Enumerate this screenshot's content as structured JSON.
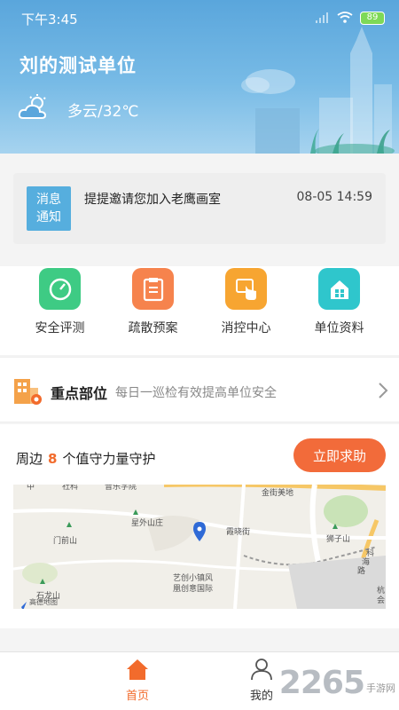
{
  "status_bar": {
    "time": "下午3:45",
    "battery": "89"
  },
  "header": {
    "unit_name": "刘的测试单位",
    "weather": "多云/32℃"
  },
  "notice": {
    "badge_line1": "消息",
    "badge_line2": "通知",
    "message": "提提邀请您加入老鹰画室",
    "time": "08-05 14:59"
  },
  "quick_actions": [
    {
      "label": "安全评测",
      "icon": "gauge-icon",
      "color": "#3ecb84"
    },
    {
      "label": "疏散预案",
      "icon": "document-icon",
      "color": "#f6834d"
    },
    {
      "label": "消控中心",
      "icon": "touch-icon",
      "color": "#f7a531"
    },
    {
      "label": "单位资料",
      "icon": "house-icon",
      "color": "#2fc6cc"
    }
  ],
  "key_part": {
    "title": "重点部位",
    "subtitle": "每日一巡检有效提高单位安全"
  },
  "nearby": {
    "prefix": "周边",
    "count": "8",
    "suffix": "个值守力量守护",
    "help_button": "立即求助"
  },
  "map": {
    "labels": [
      "金街美地",
      "星外山庄",
      "霞晓街",
      "门前山",
      "艺创小镇风",
      "凰创意国际",
      "狮子山",
      "石龙山",
      "科",
      "海",
      "路",
      "杭",
      "会",
      "高德地图",
      "中",
      "社科",
      "音乐学院"
    ]
  },
  "bottom_nav": {
    "home": "首页",
    "mine": "我的"
  },
  "watermark": {
    "number": "2265",
    "domain": "手游网"
  },
  "colors": {
    "accent": "#f26b2c",
    "header_blue": "#5aa6dc",
    "notice_blue": "#56aede"
  }
}
